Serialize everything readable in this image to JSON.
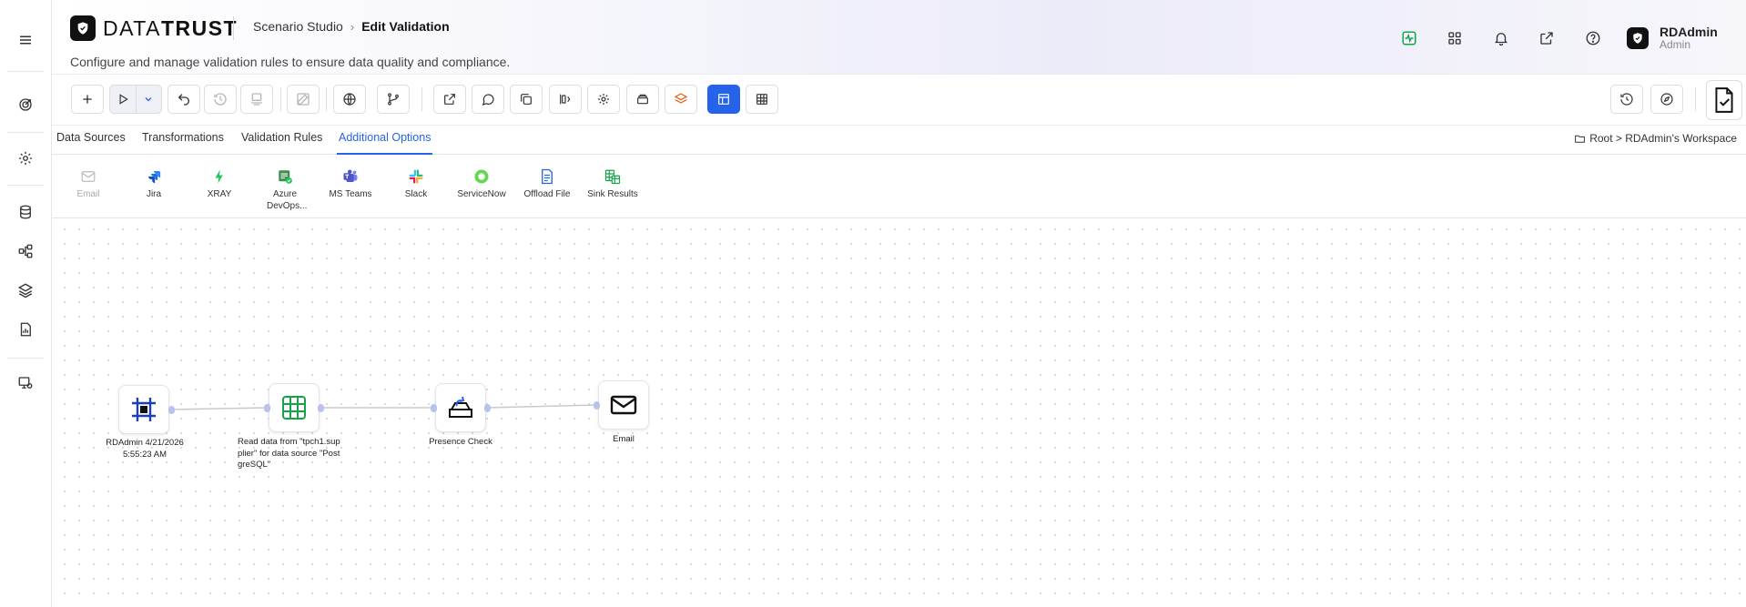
{
  "app": {
    "brand_light": "DATA",
    "brand_bold": "TRUST",
    "breadcrumb_parent": "Scenario Studio",
    "breadcrumb_current": "Edit Validation",
    "subtitle": "Configure and manage validation rules to ensure data quality and compliance.",
    "accent_color": "#2563eb"
  },
  "user": {
    "name": "RDAdmin",
    "role": "Admin"
  },
  "sidebar": {
    "items": [
      {
        "icon": "menu-icon"
      },
      {
        "icon": "target-icon"
      },
      {
        "icon": "gear-icon"
      },
      {
        "icon": "database-icon"
      },
      {
        "icon": "workflow-icon"
      },
      {
        "icon": "layers-icon"
      },
      {
        "icon": "report-icon"
      },
      {
        "icon": "monitor-settings-icon"
      }
    ]
  },
  "header_icons": [
    "activity-icon",
    "grid-icon",
    "bell-icon",
    "external-link-icon",
    "help-icon"
  ],
  "tabs": [
    {
      "label": "Data Sources"
    },
    {
      "label": "Transformations"
    },
    {
      "label": "Validation Rules"
    },
    {
      "label": "Additional Options",
      "active": true
    }
  ],
  "workspace_path": "Root > RDAdmin's Workspace",
  "palette": [
    {
      "label": "Email",
      "disabled": true
    },
    {
      "label": "Jira"
    },
    {
      "label": "XRAY"
    },
    {
      "label": "Azure DevOps..."
    },
    {
      "label": "MS Teams"
    },
    {
      "label": "Slack"
    },
    {
      "label": "ServiceNow"
    },
    {
      "label": "Offload File"
    },
    {
      "label": "Sink Results"
    }
  ],
  "nodes": [
    {
      "label": "RDAdmin 4/21/2026 5:55:23 AM",
      "icon": "start-frame-icon"
    },
    {
      "label": "Read data from \"tpch1.sup plier\" for data source \"Post greSQL\"",
      "icon": "table-icon"
    },
    {
      "label": "Presence Check",
      "icon": "presence-check-icon"
    },
    {
      "label": "Email",
      "icon": "email-icon"
    }
  ]
}
